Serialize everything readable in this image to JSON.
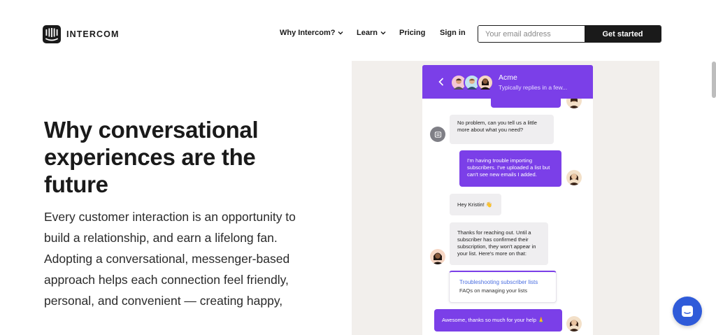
{
  "header": {
    "brand": "INTERCOM",
    "nav": [
      {
        "label": "Why Intercom?",
        "has_dropdown": true
      },
      {
        "label": "Learn",
        "has_dropdown": true
      },
      {
        "label": "Pricing",
        "has_dropdown": false
      },
      {
        "label": "Sign in",
        "has_dropdown": false
      }
    ],
    "email_placeholder": "Your email address",
    "cta_label": "Get started"
  },
  "hero": {
    "title": "Why conversational experiences are the future",
    "body": "Every customer interaction is an opportunity to build a relationship, and earn a lifelong fan. Adopting a conversational, messenger-based approach helps each connection feel friendly, personal, and convenient — creating happy,"
  },
  "messenger": {
    "team_name": "Acme",
    "reply_time": "Typically replies in a few...",
    "messages": [
      {
        "from": "agent",
        "text": "No problem, can you tell us a little more about what you need?"
      },
      {
        "from": "user",
        "text": "I'm having trouble importing subscribers. I've uploaded a list but can't see new emails I added."
      },
      {
        "from": "agent",
        "text": "Hey Kristin! 👋"
      },
      {
        "from": "agent",
        "text": "Thanks for reaching out. Until a subscriber has confirmed their subscription, they won't appear in your list. Here's more on that:"
      },
      {
        "from": "user",
        "text": "Awesome, thanks so much for your help 🙏"
      }
    ],
    "article": {
      "title": "Troubleshooting subscriber lists",
      "subtitle": "FAQs on managing your lists"
    }
  },
  "colors": {
    "brand_purple": "#7b3fe8",
    "launcher_blue": "#2f5bd9",
    "text_dark": "#1a1a1a",
    "chat_background": "#f2efec"
  }
}
